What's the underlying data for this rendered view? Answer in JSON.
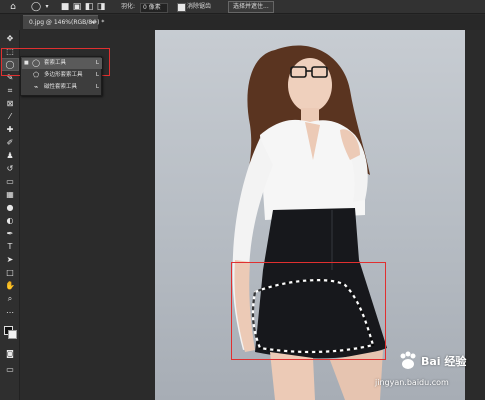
{
  "options_bar": {
    "feather_label": "羽化:",
    "feather_value": "0 像素",
    "antialias_label": "消除锯齿",
    "select_subject_button": "选择并遮住..."
  },
  "document_tab": {
    "title": "0.jpg @ 146%(RGB/8#) *"
  },
  "toolbar": {
    "tools": [
      "move-tool",
      "marquee-tool",
      "lasso-tool",
      "quick-select-tool",
      "crop-tool",
      "frame-tool",
      "eyedropper-tool",
      "healing-tool",
      "brush-tool",
      "stamp-tool",
      "history-brush-tool",
      "eraser-tool",
      "gradient-tool",
      "blur-tool",
      "dodge-tool",
      "pen-tool",
      "type-tool",
      "path-select-tool",
      "rectangle-tool",
      "hand-tool",
      "zoom-tool",
      "more-tools",
      "color-swatches",
      "quick-mask",
      "screen-mode"
    ]
  },
  "flyout": {
    "items": [
      {
        "label": "套索工具",
        "key": "L",
        "icon": "lasso-icon",
        "selected": true
      },
      {
        "label": "多边形套索工具",
        "key": "L",
        "icon": "polygonal-lasso-icon",
        "selected": false
      },
      {
        "label": "磁性套索工具",
        "key": "L",
        "icon": "magnetic-lasso-icon",
        "selected": false
      }
    ]
  },
  "watermark": {
    "brand": "Bai 经验",
    "url": "jingyan.baidu.com"
  },
  "colors": {
    "annotation": "#e03030",
    "ui_dark": "#2b2b2b",
    "panel": "#323232"
  }
}
